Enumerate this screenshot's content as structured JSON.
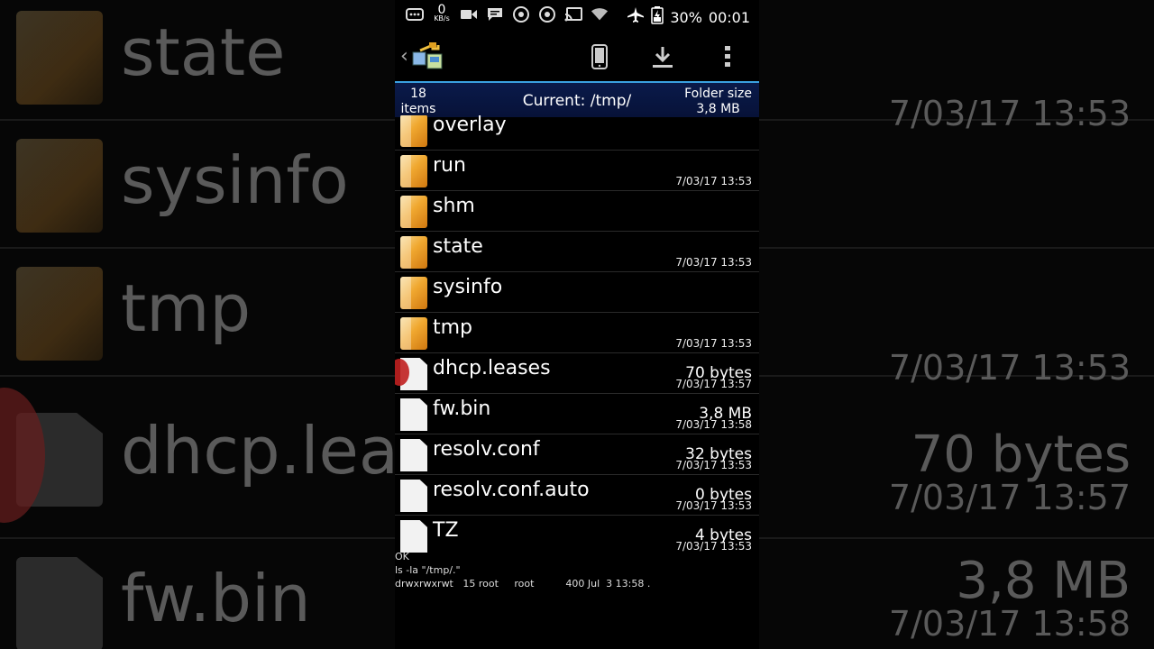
{
  "statusbar": {
    "net_speed_value": "0",
    "net_speed_unit": "KB/s",
    "battery": "30%",
    "time": "00:01",
    "icons": [
      "message-icon",
      "video-icon",
      "chat-icon",
      "chrome-icon",
      "chrome-icon",
      "cast-icon",
      "wifi-icon",
      "airplane-icon",
      "battery-icon"
    ]
  },
  "toolbar": {
    "icons": [
      "back-chevron-icon",
      "app-logo-icon",
      "phone-device-icon",
      "download-icon",
      "more-vert-icon"
    ]
  },
  "infobar": {
    "items_count": "18",
    "items_label": "items",
    "current_label": "Current: /tmp/",
    "folder_size_label": "Folder size",
    "folder_size_value": "3,8 MB"
  },
  "files": [
    {
      "name": "overlay",
      "type": "folder",
      "size": "",
      "date": ""
    },
    {
      "name": "run",
      "type": "folder",
      "size": "",
      "date": "7/03/17 13:53"
    },
    {
      "name": "shm",
      "type": "folder",
      "size": "",
      "date": ""
    },
    {
      "name": "state",
      "type": "folder",
      "size": "",
      "date": "7/03/17 13:53"
    },
    {
      "name": "sysinfo",
      "type": "folder",
      "size": "",
      "date": ""
    },
    {
      "name": "tmp",
      "type": "folder",
      "size": "",
      "date": "7/03/17 13:53"
    },
    {
      "name": "dhcp.leases",
      "type": "file",
      "size": "70 bytes",
      "date": "7/03/17 13:57"
    },
    {
      "name": "fw.bin",
      "type": "file",
      "size": "3,8 MB",
      "date": "7/03/17 13:58"
    },
    {
      "name": "resolv.conf",
      "type": "file",
      "size": "32 bytes",
      "date": "7/03/17 13:53"
    },
    {
      "name": "resolv.conf.auto",
      "type": "file",
      "size": "0 bytes",
      "date": "7/03/17 13:53"
    },
    {
      "name": "TZ",
      "type": "file",
      "size": "4 bytes",
      "date": "7/03/17 13:53"
    }
  ],
  "console": {
    "lines": [
      "OK",
      "ls -la \"/tmp/.\"",
      "drwxrwxrwt   15 root     root          400 Jul  3 13:58 ."
    ]
  },
  "background": {
    "rows": [
      {
        "name": "state",
        "size": "",
        "date": ""
      },
      {
        "name": "sysinfo",
        "size": "",
        "date": "7/03/17 13:53"
      },
      {
        "name": "tmp",
        "size": "",
        "date": ""
      },
      {
        "name": "dhcp.leas",
        "size": "",
        "date": "7/03/17 13:53"
      },
      {
        "name": "fw.bin",
        "size": "70 bytes",
        "date": "7/03/17 13:57"
      }
    ],
    "extra": {
      "size": "3,8 MB",
      "date": "7/03/17 13:58"
    }
  }
}
